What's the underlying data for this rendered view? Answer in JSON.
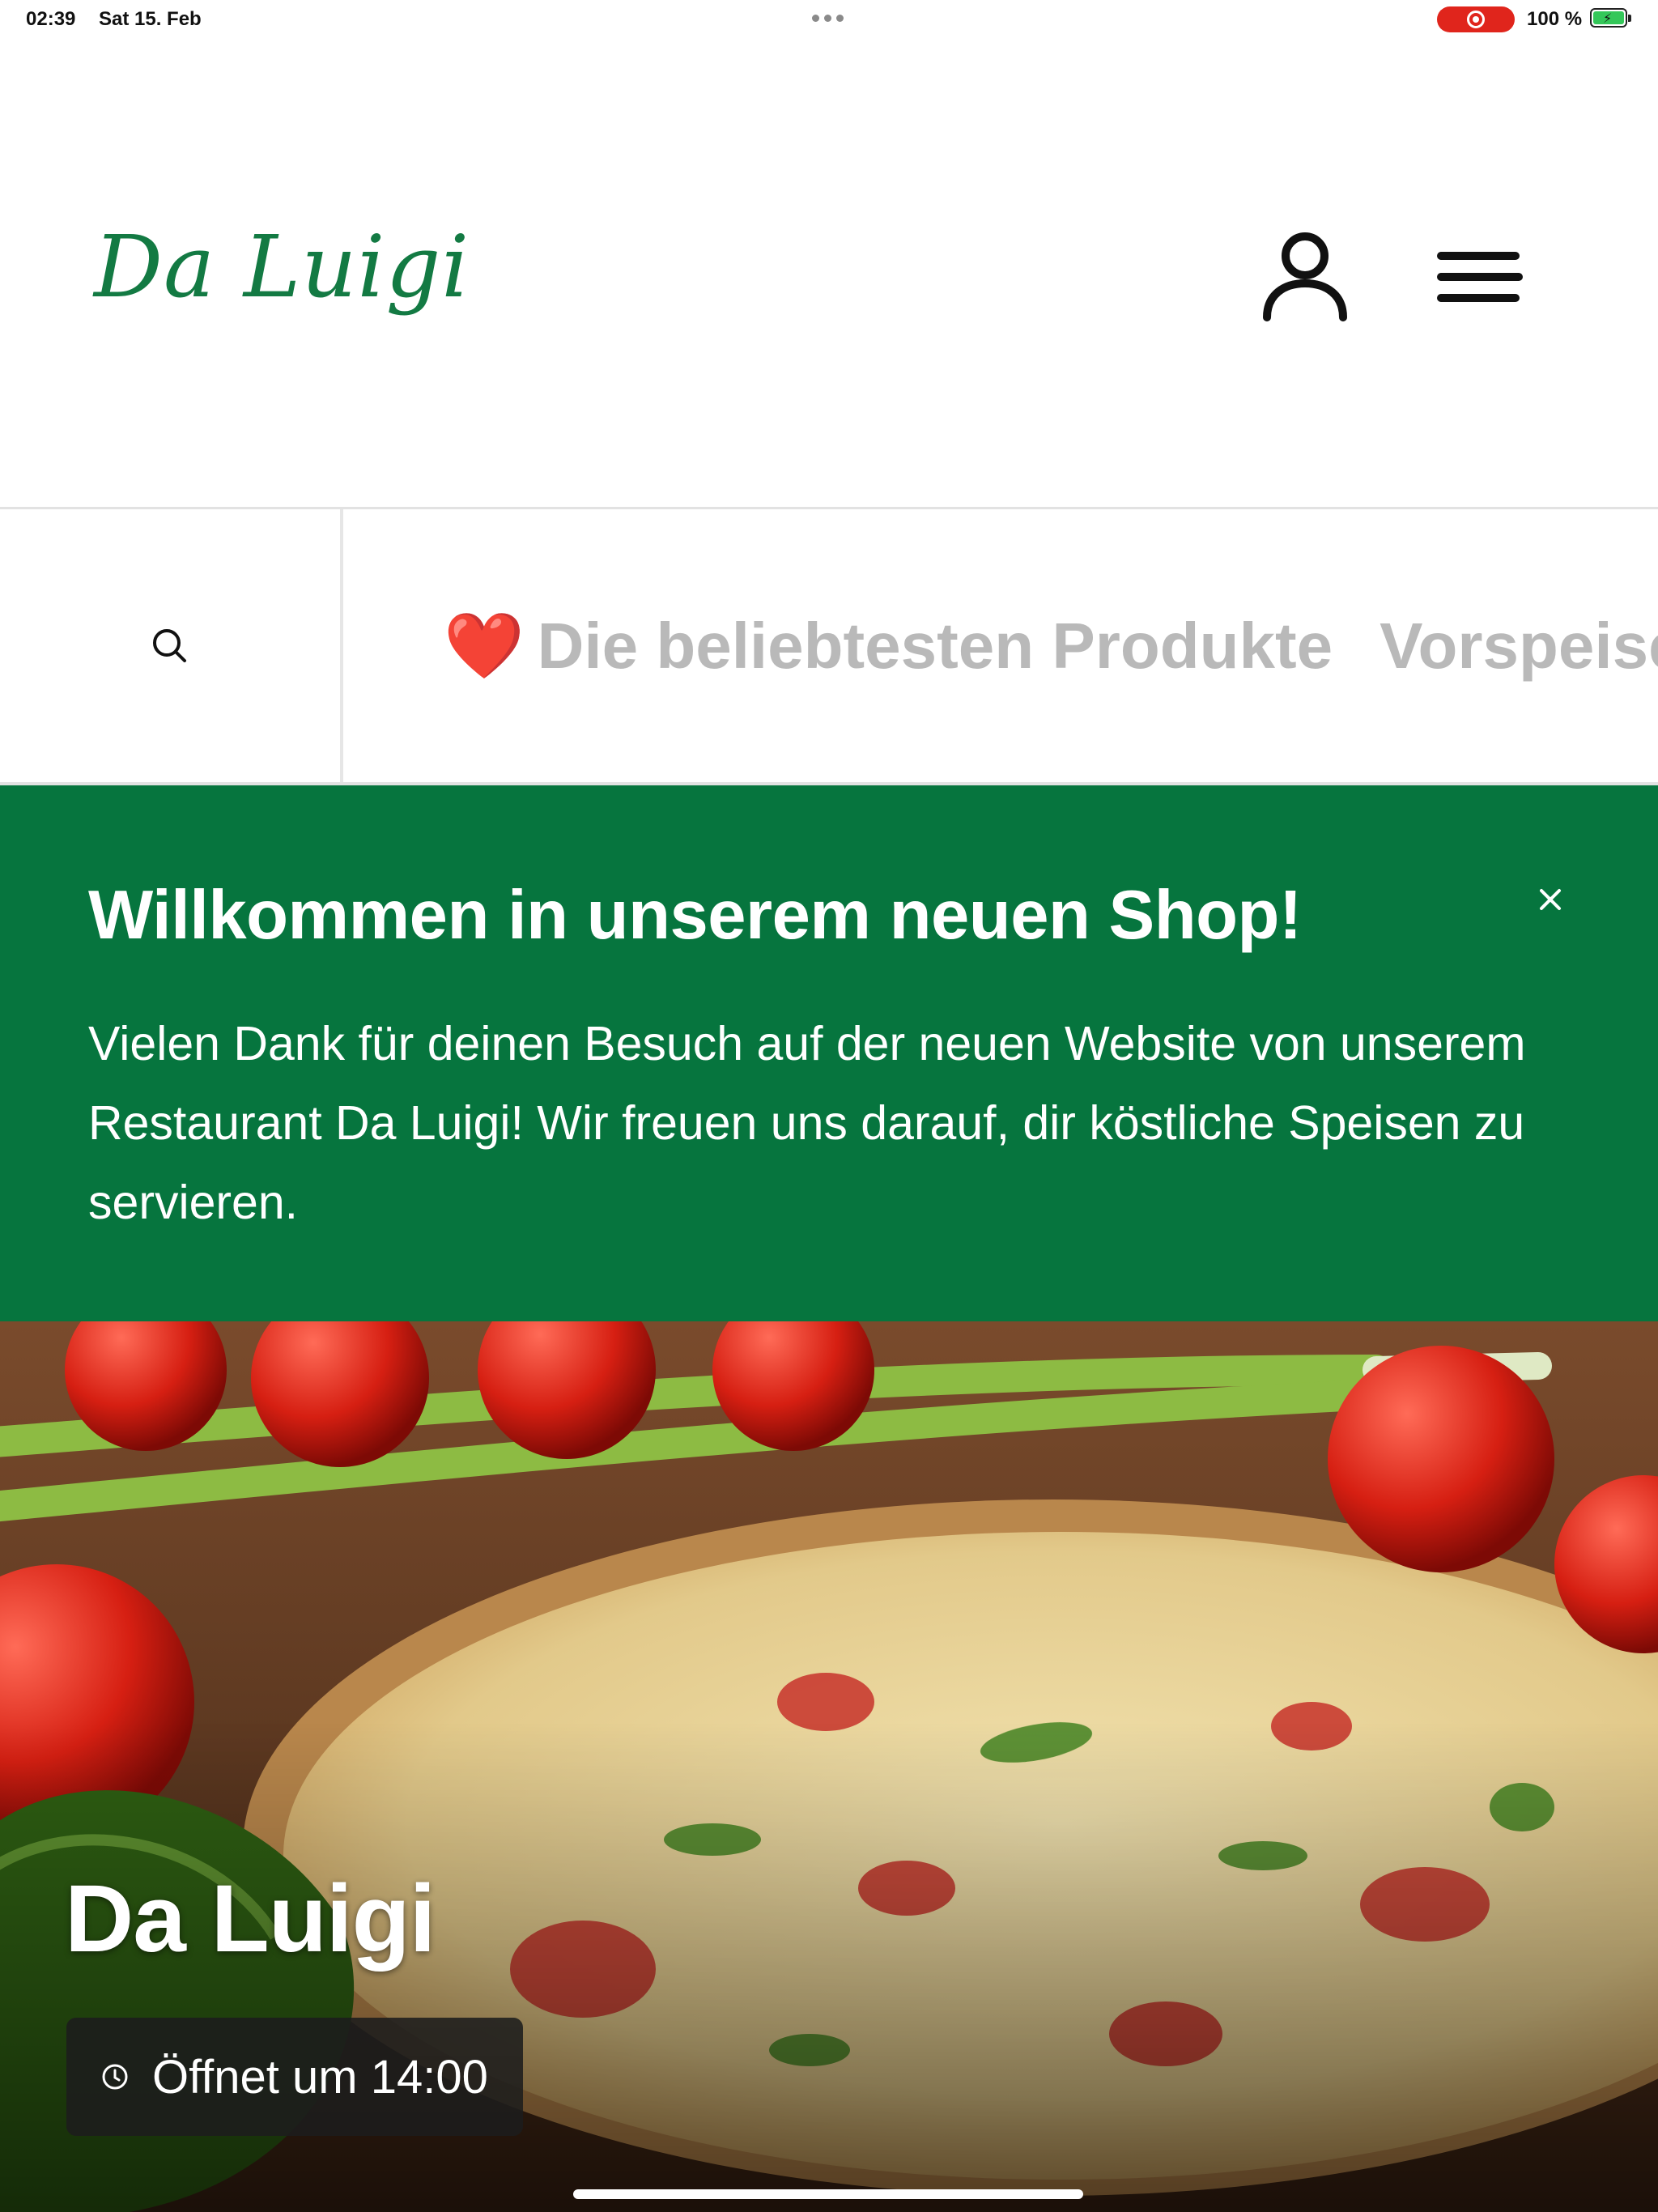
{
  "status_bar": {
    "time": "02:39",
    "date": "Sat 15. Feb",
    "battery": "100 %",
    "record_color": "#e0251c"
  },
  "header": {
    "logo_text": "Da Luigi",
    "logo_color": "#137a43",
    "account_icon": "person-icon",
    "menu_icon": "hamburger-menu-icon"
  },
  "category_bar": {
    "search_icon": "search-icon",
    "items": [
      {
        "emoji": "❤️",
        "label": "Die beliebtesten Produkte"
      },
      {
        "label": "Vorspeisen"
      }
    ]
  },
  "banner": {
    "title": "Willkommen in unserem neuen Shop!",
    "text": "Vielen Dank für deinen Besuch auf der neuen Website von unserem Restaurant Da Luigi! Wir freuen uns darauf, dir köstliche Speisen zu servieren.",
    "background": "#06753e",
    "close_icon": "close-icon"
  },
  "hero": {
    "title": "Da Luigi",
    "opening_status": "Öffnet um 14:00",
    "clock_icon": "clock-icon"
  }
}
